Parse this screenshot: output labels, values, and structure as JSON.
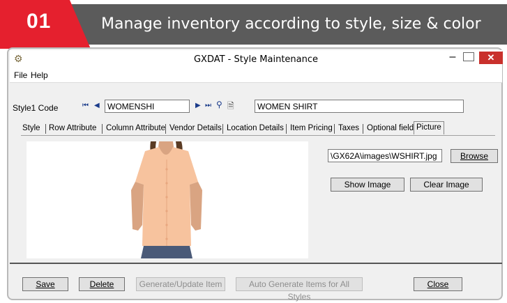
{
  "banner": {
    "number": "01",
    "title": "Manage inventory according to style, size & color",
    "accent": "#e5202e",
    "dark": "#5b5b5b"
  },
  "window": {
    "title": "GXDAT - Style Maintenance",
    "min_glyph": "–",
    "close_glyph": "✕",
    "icon": "gear-icon"
  },
  "menu": [
    {
      "label": "File"
    },
    {
      "label": "Help"
    }
  ],
  "form": {
    "code_label": "Style1 Code",
    "code_value": "WOMENSHI",
    "desc_value": "WOMEN SHIRT"
  },
  "tabs": [
    {
      "label": "Style"
    },
    {
      "label": "Row Attribute"
    },
    {
      "label": "Column Attribute"
    },
    {
      "label": "Vendor Details"
    },
    {
      "label": "Location Details"
    },
    {
      "label": "Item Pricing"
    },
    {
      "label": "Taxes"
    },
    {
      "label": "Optional field"
    },
    {
      "label": "Picture",
      "selected": true
    }
  ],
  "picture": {
    "path": "\\GX62A\\images\\WSHIRT.jpg",
    "browse_label": "Browse",
    "show_label": "Show Image",
    "clear_label": "Clear Image"
  },
  "footer": {
    "save": "Save",
    "delete": "Delete",
    "generate": "Generate/Update Item",
    "auto_generate": "Auto Generate Items for All Styles",
    "close": "Close"
  }
}
